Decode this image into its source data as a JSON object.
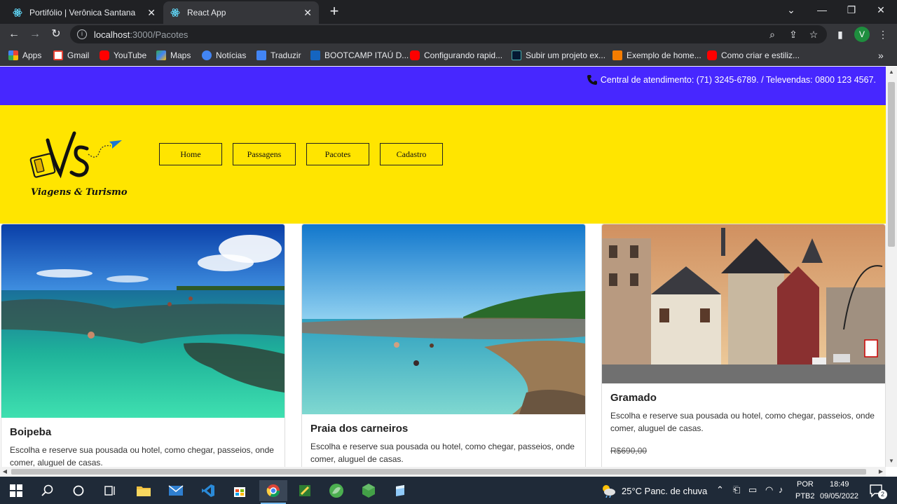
{
  "browser": {
    "tabs": [
      {
        "title": "Portifólio | Verônica Santana",
        "active": false
      },
      {
        "title": "React App",
        "active": true
      }
    ],
    "url_host": "localhost",
    "url_path": ":3000/Pacotes",
    "profile_initial": "V",
    "bookmarks": [
      {
        "label": "Apps",
        "icon": "apps-grid-icon",
        "color": "#e8453c"
      },
      {
        "label": "Gmail",
        "icon": "gmail-icon",
        "color": "#ea4335"
      },
      {
        "label": "YouTube",
        "icon": "youtube-icon",
        "color": "#ff0000"
      },
      {
        "label": "Maps",
        "icon": "maps-icon",
        "color": "#34a853"
      },
      {
        "label": "Notícias",
        "icon": "news-icon",
        "color": "#4285f4"
      },
      {
        "label": "Traduzir",
        "icon": "translate-icon",
        "color": "#4285f4"
      },
      {
        "label": "BOOTCAMP ITAÚ D...",
        "icon": "dio-icon",
        "color": "#1565c0"
      },
      {
        "label": "Configurando rapid...",
        "icon": "youtube-icon",
        "color": "#ff0000"
      },
      {
        "label": "Subir um projeto ex...",
        "icon": "alura-icon",
        "color": "#051933"
      },
      {
        "label": "Exemplo de home...",
        "icon": "bookmark-orange-icon",
        "color": "#f57c00"
      },
      {
        "label": "Como criar e estiliz...",
        "icon": "youtube-icon",
        "color": "#ff0000"
      }
    ]
  },
  "site": {
    "contact": "Central de atendimento: (71) 3245-6789. / Televendas: 0800 123 4567.",
    "logo_text": "Viagens & Turismo",
    "logo_initials": "VS",
    "nav": [
      "Home",
      "Passagens",
      "Pacotes",
      "Cadastro"
    ],
    "colors": {
      "topbar": "#4727ff",
      "header": "#ffe500"
    },
    "cards": [
      {
        "title": "Boipeba",
        "text": "Escolha e reserve sua pousada ou hotel, como chegar, passeios, onde comer, aluguel de casas."
      },
      {
        "title": "Praia dos carneiros",
        "text": "Escolha e reserve sua pousada ou hotel, como chegar, passeios, onde comer, aluguel de casas."
      },
      {
        "title": "Gramado",
        "text": "Escolha e reserve sua pousada ou hotel, como chegar, passeios, onde comer, aluguel de casas.",
        "price": "R$690,00"
      }
    ]
  },
  "taskbar": {
    "weather": "25°C  Panc. de chuva",
    "lang_top": "POR",
    "lang_bottom": "PTB2",
    "time": "18:49",
    "date": "09/05/2022",
    "notifications": "2"
  }
}
